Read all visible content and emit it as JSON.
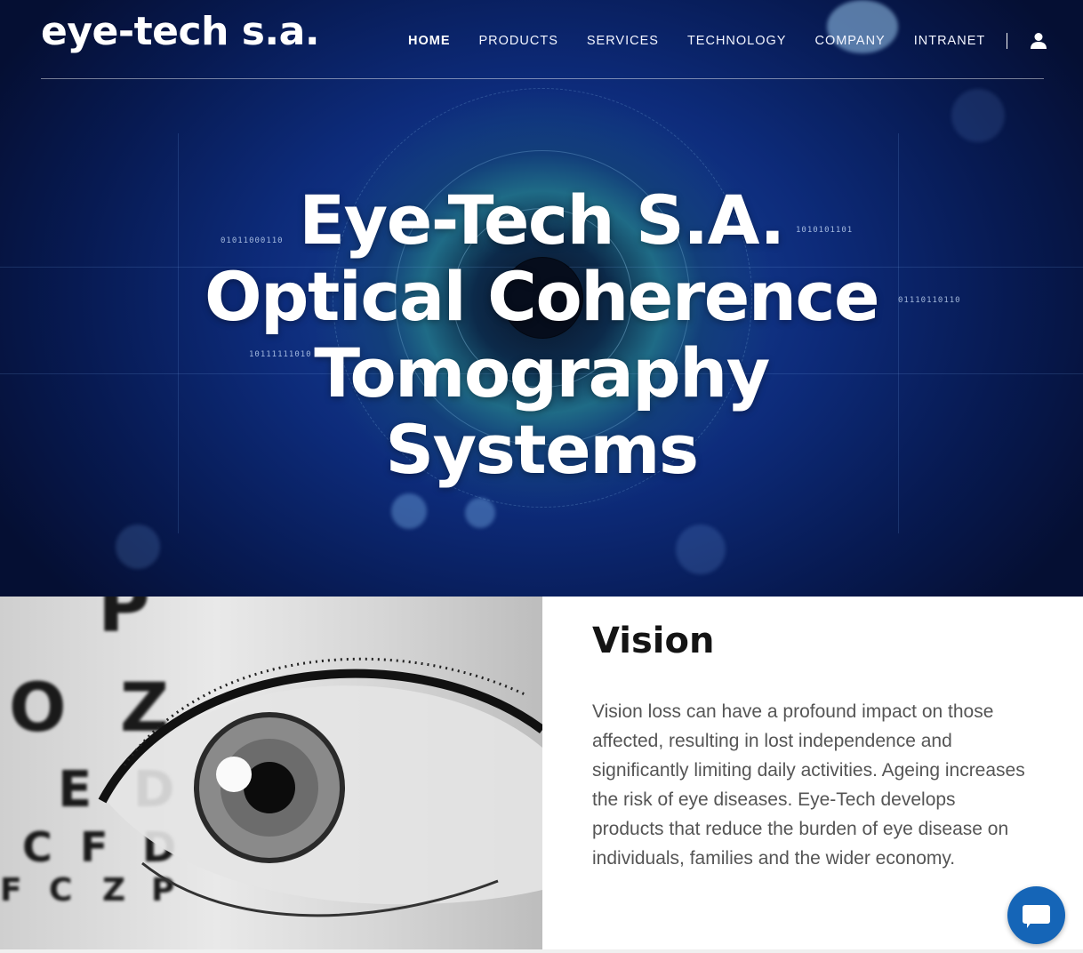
{
  "header": {
    "logo": "eye-tech s.a.",
    "nav": [
      {
        "label": "HOME",
        "active": true
      },
      {
        "label": "PRODUCTS",
        "active": false
      },
      {
        "label": "SERVICES",
        "active": false
      },
      {
        "label": "TECHNOLOGY",
        "active": false
      },
      {
        "label": "COMPANY",
        "active": false
      },
      {
        "label": "INTRANET",
        "active": false
      }
    ],
    "account_icon": "user-icon"
  },
  "hero": {
    "title_lines": [
      "Eye-Tech S.A.",
      "Optical Coherence",
      "Tomography",
      "Systems"
    ],
    "digits": [
      "01011000110",
      "10111111010",
      "01110110110",
      "1010101101"
    ]
  },
  "vision": {
    "heading": "Vision",
    "body": "Vision loss can have a profound impact on those affected, resulting in lost independence and significantly limiting daily activities. Ageing increases the risk of eye diseases. Eye-Tech develops products that reduce the burden of eye disease on individuals, families and the wider economy."
  },
  "eye_chart_letters": [
    "P",
    "O",
    "Z",
    "E",
    "D",
    "C",
    "F",
    "D",
    "F",
    "C",
    "Z",
    "P"
  ],
  "chat": {
    "icon": "chat-bubble-icon"
  },
  "colors": {
    "chat_button": "#1565b7",
    "hero_blue": "#0d2b7a",
    "heading": "#141414",
    "body_text": "#555555"
  }
}
